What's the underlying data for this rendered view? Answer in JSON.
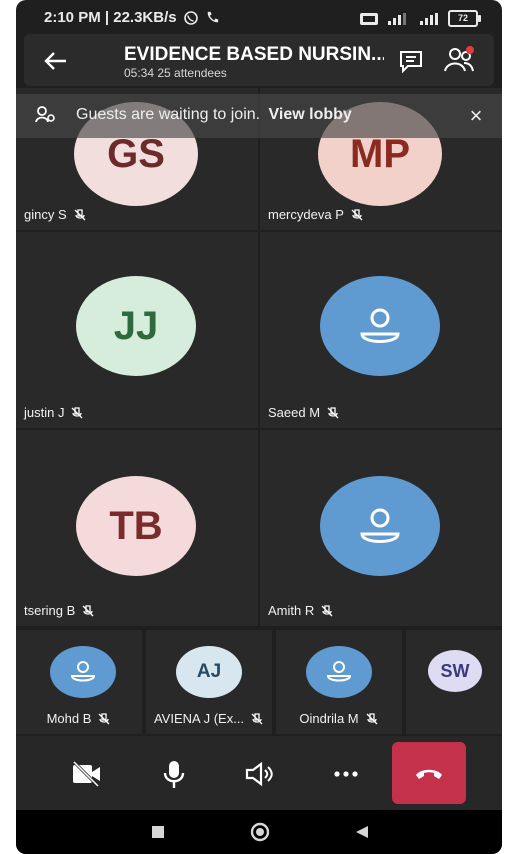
{
  "status_bar": {
    "time_speed": "2:10 PM | 22.3KB/s",
    "battery": "72"
  },
  "header": {
    "title": "EVIDENCE BASED NURSIN...",
    "duration": "05:34",
    "attendees": "25 attendees"
  },
  "banner": {
    "message": "Guests are waiting to join.",
    "action": "View lobby"
  },
  "tiles": [
    {
      "initials": "GS",
      "name": "gincy S",
      "avatar_bg": "#f3dede",
      "avatar_fg": "#6b2b2b"
    },
    {
      "initials": "MP",
      "name": "mercydeva P",
      "avatar_bg": "#f1d1c9",
      "avatar_fg": "#8a2a21"
    },
    {
      "initials": "JJ",
      "name": "justin J",
      "avatar_bg": "#d7eddc",
      "avatar_fg": "#2d6a3d"
    },
    {
      "initials": "",
      "name": "Saeed M",
      "avatar_bg": "#5f9ad1",
      "avatar_fg": "#ffffff"
    },
    {
      "initials": "TB",
      "name": "tsering B",
      "avatar_bg": "#f4dada",
      "avatar_fg": "#7a2b2b"
    },
    {
      "initials": "",
      "name": "Amith R",
      "avatar_bg": "#5f9ad1",
      "avatar_fg": "#ffffff"
    }
  ],
  "mini_tiles": [
    {
      "initials": "",
      "name": "Mohd B",
      "avatar_bg": "#5f9ad1",
      "avatar_fg": "#ffffff"
    },
    {
      "initials": "AJ",
      "name": "AVIENA J (Ex...",
      "avatar_bg": "#d8e6ef",
      "avatar_fg": "#224b66"
    },
    {
      "initials": "",
      "name": "Oindrila M",
      "avatar_bg": "#5f9ad1",
      "avatar_fg": "#ffffff"
    },
    {
      "initials": "SW",
      "name": "",
      "avatar_bg": "#dedcf2",
      "avatar_fg": "#3c3a79"
    }
  ],
  "controls": {
    "icons": [
      "camera-off-icon",
      "microphone-icon",
      "speaker-icon",
      "more-icon",
      "hang-up-icon"
    ],
    "hangup_color": "#c4314b"
  },
  "navigation": {
    "icons": [
      "recent-apps-icon",
      "home-icon",
      "back-icon"
    ]
  }
}
